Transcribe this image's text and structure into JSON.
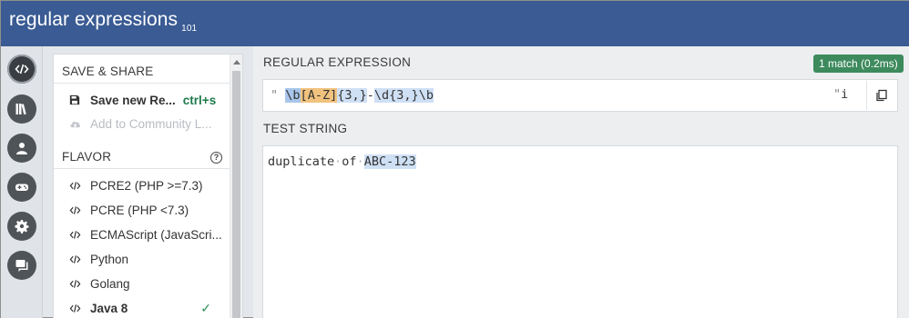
{
  "header": {
    "logo": "regular expressions",
    "logo_sub": "101"
  },
  "rail": {
    "buttons": [
      {
        "icon": "code-icon",
        "active": true
      },
      {
        "icon": "library-icon"
      },
      {
        "icon": "user-icon"
      },
      {
        "icon": "gamepad-icon"
      },
      {
        "icon": "gear-icon"
      },
      {
        "icon": "chat-icon"
      }
    ]
  },
  "sidebar": {
    "save_title": "SAVE & SHARE",
    "save_new": "Save new Re...",
    "save_shortcut": "ctrl+s",
    "add_community": "Add to Community L...",
    "flavor_title": "FLAVOR",
    "help": "?",
    "flavors": [
      {
        "label": "PCRE2 (PHP >=7.3)"
      },
      {
        "label": "PCRE (PHP <7.3)"
      },
      {
        "label": "ECMAScript (JavaScri..."
      },
      {
        "label": "Python"
      },
      {
        "label": "Golang"
      },
      {
        "label": "Java 8",
        "selected": true
      }
    ],
    "checkmark": "✓"
  },
  "main": {
    "regex_label": "REGULAR EXPRESSION",
    "match_badge": "1 match (0.2ms)",
    "regex_open_delim": "\"",
    "regex_parts": [
      "\\b",
      "[",
      "A",
      "-",
      "Z",
      "]",
      "{3,}",
      "-",
      "\\d",
      "{3,}",
      "\\b"
    ],
    "regex_close_delim": "\"",
    "regex_flags": "i",
    "test_label": "TEST STRING",
    "test_parts": [
      "duplicate",
      "·",
      "of",
      "·",
      "ABC-123"
    ]
  },
  "colors": {
    "header": "#3a5b93",
    "match_badge": "#3d8a5d",
    "highlight_blue": "#a8c6ea",
    "highlight_orange": "#f1c27e"
  }
}
